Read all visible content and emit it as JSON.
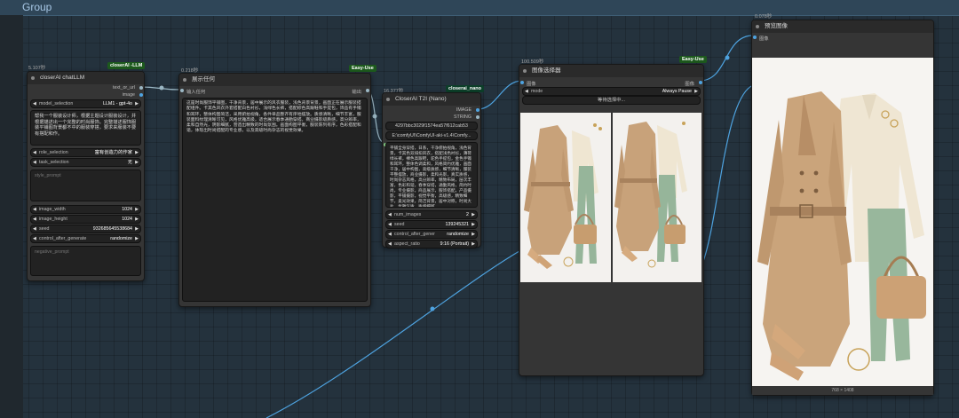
{
  "canvas": {
    "group_title": "Group"
  },
  "node_llm": {
    "timing": "5.107秒",
    "badge": "closerAI -LLM",
    "title": "closerAI chatLLM",
    "outputs": [
      "text_or_url",
      "image"
    ],
    "model_selection_label": "model_selection",
    "model_selection_value": "LLM1 - gpt-4o",
    "prompt_text": "帮我一个服装设计师，根据主题设计服装设计，并根据描述出一个完整的时尚服饰。完整描述服饰服装平铺图背景都不中的服装穿搭，要求来服装不要有搭配和作。",
    "role_selection_label": "role_selection",
    "role_selection_value": "富有创造力的作家",
    "task_selection_label": "task_selection",
    "task_selection_value": "无",
    "style_placeholder": "style_prompt",
    "image_width_label": "image_width",
    "image_width_value": "1024",
    "image_height_label": "image_height",
    "image_height_value": "1024",
    "seed_label": "seed",
    "seed_value": "932685645538684",
    "control_label": "control_after_generate",
    "control_value": "randomize",
    "negative_placeholder": "negative_prompt"
  },
  "node_text": {
    "timing": "0.218秒",
    "badge": "Easy-Use",
    "title": "展示任何",
    "input_label": "输入任何",
    "output_label": "输出",
    "body": "这是时尚服饰平铺图，干净背景，居中展示的风衣服装，浅色背景背景，画面正在展示服装搭配组件。卡其色风衣外套搭配白色衬衫，浅绿色长裤，搭配棕色高跟鞋和手提包，饰品有手镯和耳环，整体构图简洁，采用俯拍视角，各件单品整齐有序地摆放。质感清晰，细节丰富，服装面料纹理清晰可见，风格优雅高级，适合展示春季通勤穿搭。商业摄影级质感，高分辨率，柔和自然光，阴影细腻，营造出精致的时尚氛围。画面构图平衡，服装陈列有序，色彩搭配和谐，体现出时尚搭配的专业感，以及高级时尚杂志的视觉效果。"
  },
  "node_t2i": {
    "timing": "16.377秒",
    "badge": "closerai_nano",
    "title": "CloserAI T2I (Nano)",
    "outputs": [
      "IMAGE",
      "STRING"
    ],
    "hash": "4297bbc3029f1574ea57f612cab53",
    "path": "E:\\comfyUI\\ComfyUI-aki-v1.4\\Comfy...",
    "prompt_text": "平铺全身穿搭，日系，干净俯拍视角，浅色背景，卡其色双排扣风衣，搭配浅色衬衫，薄荷绿长裤，裸色高跟鞋，驼色手提包，金色手镯和耳环，整体色调柔和，风格简约优雅，画面干净，居中构图，高级质感，细节清晰，服装平整摆放，商业摄影，柔和光影，真实质感，时尚杂志风格，高分辨率，精致布局，层次丰富，色彩和谐，春季穿搭，通勤风格，简约时尚，专业摄影，商品展示，服饰搭配，产品摄影，平铺摄影，视觉平衡，高级感，精致细节，柔光效果，简洁背景，居中对称，时尚大片，优雅气质，质感细腻",
    "num_images_label": "num_images",
    "num_images_value": "2",
    "seed_label": "seed",
    "seed_value": "139245321",
    "control_label": "control_after_gener",
    "control_value": "randomize",
    "aspect_label": "aspect_ratio",
    "aspect_value": "9:16 (Portrait)"
  },
  "node_selector": {
    "timing": "100.509秒",
    "badge": "Easy-Use",
    "title": "图像选择器",
    "input_label": "图像",
    "output_label": "图像",
    "mode_label": "mode",
    "mode_value": "Always Pause",
    "waiting": "等待选择中..."
  },
  "node_preview": {
    "timing": "0.078秒",
    "title": "预览图像",
    "input_label": "图像",
    "size_label": "768 × 1408"
  }
}
